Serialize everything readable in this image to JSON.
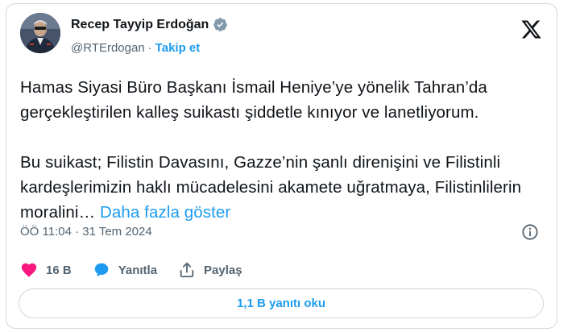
{
  "author": {
    "name": "Recep Tayyip Erdoğan",
    "handle": "@RTErdogan",
    "separator": "·",
    "follow_label": "Takip et"
  },
  "tweet": {
    "paragraph1": "Hamas Siyasi Büro Başkanı İsmail Heniye’ye yönelik Tahran’da gerçekleştirilen kalleş suikastı şiddetle kınıyor ve lanetliyorum.",
    "paragraph2": "Bu suikast; Filistin Davasını, Gazze’nin şanlı direnişini ve Filistinli kardeşlerimizin haklı mücadelesini akamete uğratmaya, Filistinlilerin moralini…",
    "show_more_label": "Daha fazla göster"
  },
  "timestamp": "ÖÖ 11:04 · 31 Tem 2024",
  "actions": {
    "like_count": "16 B",
    "reply_label": "Yanıtla",
    "share_label": "Paylaş"
  },
  "read_replies_label": "1,1 B yanıtı oku",
  "colors": {
    "accent": "#1d9bf0",
    "like": "#f91880",
    "text": "#0f1419",
    "secondary": "#536471",
    "border": "#cfd9de"
  },
  "icons": {
    "verified": "verified-badge-icon",
    "platform": "x-logo-icon",
    "info": "info-icon",
    "like": "heart-icon",
    "reply": "speech-bubble-icon",
    "share": "share-icon"
  }
}
